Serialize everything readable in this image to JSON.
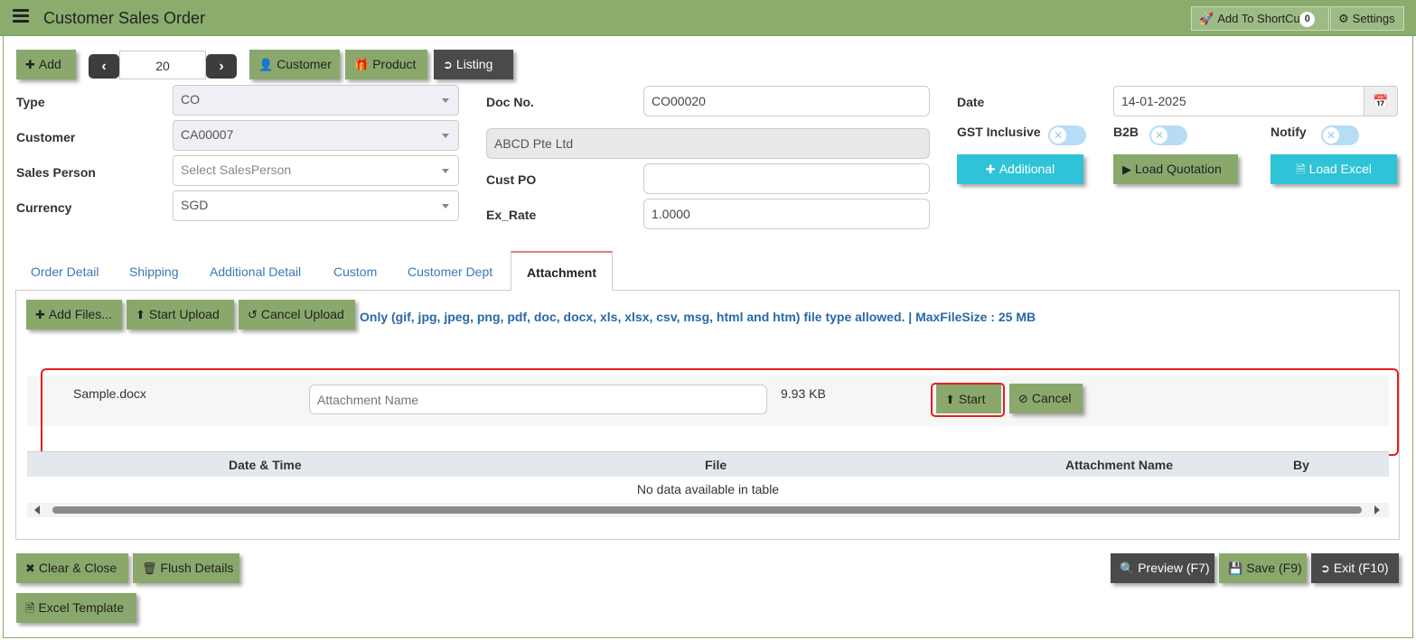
{
  "header": {
    "title": "Customer Sales Order",
    "add_shortcut_label": "Add To ShortCut",
    "shortcut_count": "0",
    "settings_label": "Settings"
  },
  "toolbar": {
    "add_label": "Add",
    "pager_value": "20",
    "customer_label": "Customer",
    "product_label": "Product",
    "listing_label": "Listing"
  },
  "form": {
    "type_label": "Type",
    "type_value": "CO",
    "customer_label": "Customer",
    "customer_value": "CA00007",
    "sales_person_label": "Sales Person",
    "sales_person_placeholder": "Select SalesPerson",
    "currency_label": "Currency",
    "currency_value": "SGD",
    "doc_no_label": "Doc No.",
    "doc_no_value": "CO00020",
    "customer_name_value": "ABCD Pte Ltd",
    "cust_po_label": "Cust PO",
    "cust_po_value": "",
    "ex_rate_label": "Ex_Rate",
    "ex_rate_value": "1.0000",
    "date_label": "Date",
    "date_value": "14-01-2025",
    "gst_inclusive_label": "GST Inclusive",
    "b2b_label": "B2B",
    "notify_label": "Notify",
    "additional_label": "Additional",
    "load_quotation_label": "Load Quotation",
    "load_excel_label": "Load Excel"
  },
  "tabs": [
    {
      "label": "Order Detail"
    },
    {
      "label": "Shipping"
    },
    {
      "label": "Additional Detail"
    },
    {
      "label": "Custom"
    },
    {
      "label": "Customer Dept"
    },
    {
      "label": "Attachment"
    }
  ],
  "attachment": {
    "add_files_label": "Add Files...",
    "start_upload_label": "Start Upload",
    "cancel_upload_label": "Cancel Upload",
    "info_text": "Only (gif, jpg, jpeg, png, pdf, doc, docx, xls, xlsx, csv, msg, html and htm) file type allowed. | MaxFileSize : 25 MB",
    "file": {
      "name": "Sample.docx",
      "attachment_name_placeholder": "Attachment Name",
      "size": "9.93 KB",
      "start_label": "Start",
      "cancel_label": "Cancel"
    },
    "table": {
      "columns": [
        "Date & Time",
        "File",
        "Attachment Name",
        "By"
      ],
      "empty_text": "No data available in table"
    }
  },
  "footer": {
    "clear_close_label": "Clear & Close",
    "flush_details_label": "Flush Details",
    "excel_template_label": "Excel Template",
    "preview_label": "Preview (F7)",
    "save_label": "Save (F9)",
    "exit_label": "Exit (F10)"
  },
  "colors": {
    "header_green": "#8aad6e",
    "button_green": "#8aa86c",
    "button_dark": "#4a4a4a",
    "button_cyan": "#2ec3d6",
    "highlight_red": "#e02020",
    "info_blue": "#2a68a8"
  }
}
